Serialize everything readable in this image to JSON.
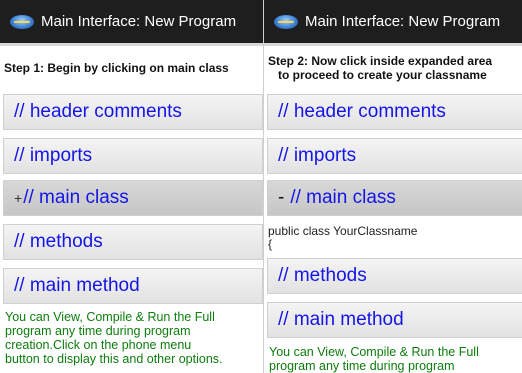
{
  "left": {
    "title": "Main Interface: New Program",
    "step": "Step 1: Begin by clicking on main class",
    "items": [
      {
        "label": "// header comments"
      },
      {
        "label": "// imports"
      },
      {
        "prefix": "+",
        "label": "// main class"
      },
      {
        "label": "// methods"
      },
      {
        "label": "// main method"
      }
    ],
    "info_lines": [
      "You can View, Compile & Run the Full",
      "program any time during program",
      "creation.Click on the phone menu",
      "button to display this and other options."
    ]
  },
  "right": {
    "title": "Main Interface: New Program",
    "step_line1": "Step 2: Now click inside expanded area",
    "step_line2": "to proceed to create your classname",
    "items": [
      {
        "label": "// header comments"
      },
      {
        "label": "// imports"
      },
      {
        "prefix": "-",
        "label": "// main class"
      },
      {
        "label": "// methods"
      },
      {
        "label": "// main method"
      }
    ],
    "code_line1": "public class YourClassname",
    "code_line2": "{",
    "info_lines": [
      "You can View, Compile & Run the Full",
      "program any time during program"
    ]
  },
  "colors": {
    "titlebar": "#1e1e1e",
    "item_text": "#1515e6",
    "info_text": "#0d7d0d"
  }
}
